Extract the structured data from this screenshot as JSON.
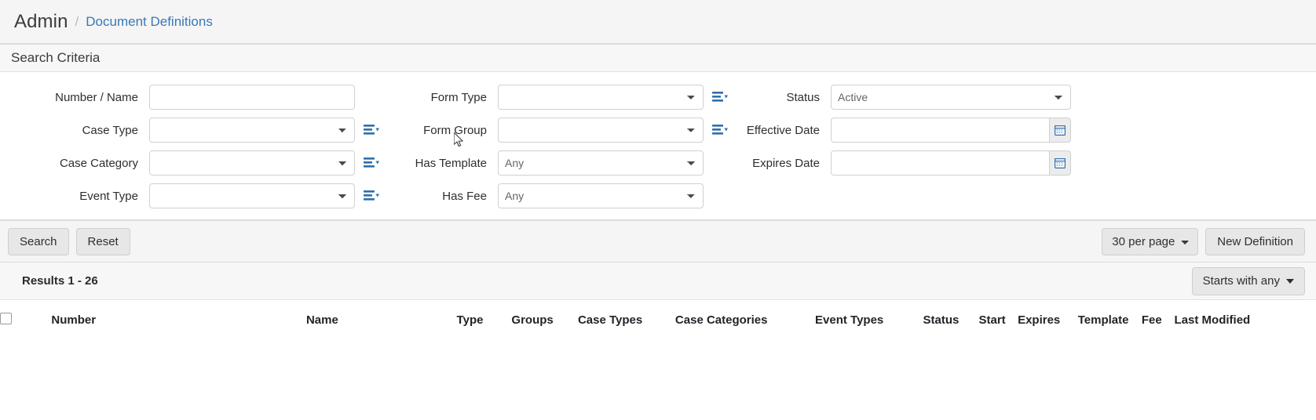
{
  "breadcrumb": {
    "root": "Admin",
    "separator": "/",
    "current": "Document Definitions"
  },
  "search_panel": {
    "title": "Search Criteria",
    "fields": {
      "number_name": {
        "label": "Number / Name",
        "value": "",
        "placeholder": ""
      },
      "case_type": {
        "label": "Case Type",
        "value": ""
      },
      "case_category": {
        "label": "Case Category",
        "value": ""
      },
      "event_type": {
        "label": "Event Type",
        "value": ""
      },
      "form_type": {
        "label": "Form Type",
        "value": ""
      },
      "form_group": {
        "label": "Form Group",
        "value": ""
      },
      "has_template": {
        "label": "Has Template",
        "value": "Any"
      },
      "has_fee": {
        "label": "Has Fee",
        "value": "Any"
      },
      "status": {
        "label": "Status",
        "value": "Active"
      },
      "effective_date": {
        "label": "Effective Date",
        "value": "",
        "placeholder": ""
      },
      "expires_date": {
        "label": "Expires Date",
        "value": "",
        "placeholder": ""
      }
    },
    "options": {
      "any": "Any",
      "active": "Active",
      "blank": ""
    }
  },
  "actions": {
    "search_label": "Search",
    "reset_label": "Reset",
    "per_page_value": "30 per page",
    "new_definition_label": "New Definition"
  },
  "results": {
    "count_label": "Results 1 - 26",
    "match_mode_label": "Starts with any",
    "columns": [
      "Number",
      "Name",
      "Type",
      "Groups",
      "Case Types",
      "Case Categories",
      "Event Types",
      "Status",
      "Start",
      "Expires",
      "Template",
      "Fee",
      "Last Modified"
    ],
    "rows": []
  },
  "colors": {
    "link": "#3a78b5",
    "icon_blue": "#2f6fad",
    "panel_head_bg": "#f7f7f7",
    "action_bg": "#f5f5f5",
    "button_bg": "#e7e7e7",
    "border": "#dcdcdc"
  },
  "icons": {
    "list_dropdown": "list-dropdown-icon",
    "calendar": "calendar-icon",
    "caret_down": "caret-down-icon",
    "checkbox": "checkbox-icon"
  }
}
